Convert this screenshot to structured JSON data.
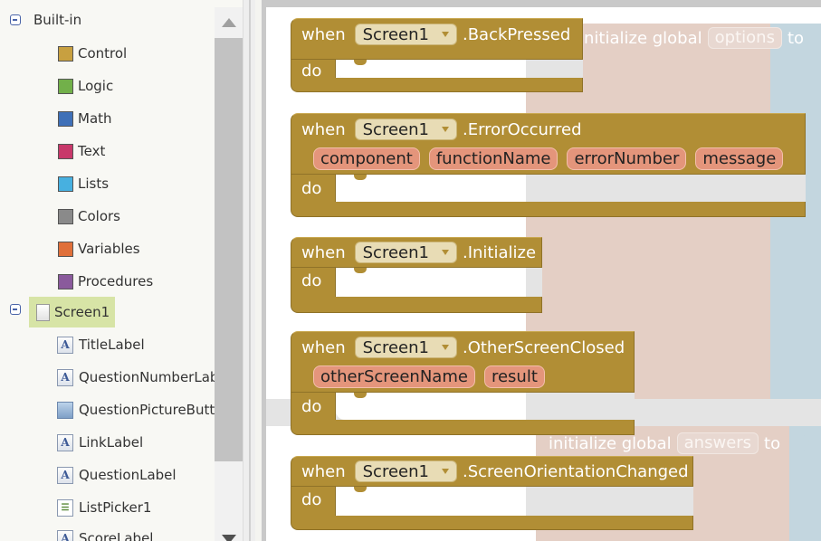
{
  "tree": {
    "builtin_label": "Built-in",
    "categories": [
      {
        "label": "Control",
        "color": "#c8a040"
      },
      {
        "label": "Logic",
        "color": "#72b04a"
      },
      {
        "label": "Math",
        "color": "#3f70b8"
      },
      {
        "label": "Text",
        "color": "#c8386a"
      },
      {
        "label": "Lists",
        "color": "#47b0e0"
      },
      {
        "label": "Colors",
        "color": "#8a8a8a"
      },
      {
        "label": "Variables",
        "color": "#e0703a"
      },
      {
        "label": "Procedures",
        "color": "#8a5a9c"
      }
    ],
    "screen_label": "Screen1",
    "components": [
      {
        "label": "TitleLabel",
        "icon": "label-icon"
      },
      {
        "label": "QuestionNumberLabel",
        "icon": "label-icon"
      },
      {
        "label": "QuestionPictureButton",
        "icon": "image-button-icon"
      },
      {
        "label": "LinkLabel",
        "icon": "label-icon"
      },
      {
        "label": "QuestionLabel",
        "icon": "label-icon"
      },
      {
        "label": "ListPicker1",
        "icon": "listpicker-icon"
      },
      {
        "label": "ScoreLabel",
        "icon": "label-icon"
      }
    ]
  },
  "workspace": {
    "ghost1": {
      "prefix": "initialize global",
      "name": "options",
      "suffix": "to"
    },
    "ghost2": {
      "prefix": "initialize global",
      "name": "answers",
      "suffix": "to"
    },
    "when_label": "when",
    "do_label": "do",
    "component": "Screen1",
    "events": [
      {
        "name": ".BackPressed",
        "params": []
      },
      {
        "name": ".ErrorOccurred",
        "params": [
          "component",
          "functionName",
          "errorNumber",
          "message"
        ]
      },
      {
        "name": ".Initialize",
        "params": []
      },
      {
        "name": ".OtherScreenClosed",
        "params": [
          "otherScreenName",
          "result"
        ]
      },
      {
        "name": ".ScreenOrientationChanged",
        "params": []
      }
    ]
  }
}
